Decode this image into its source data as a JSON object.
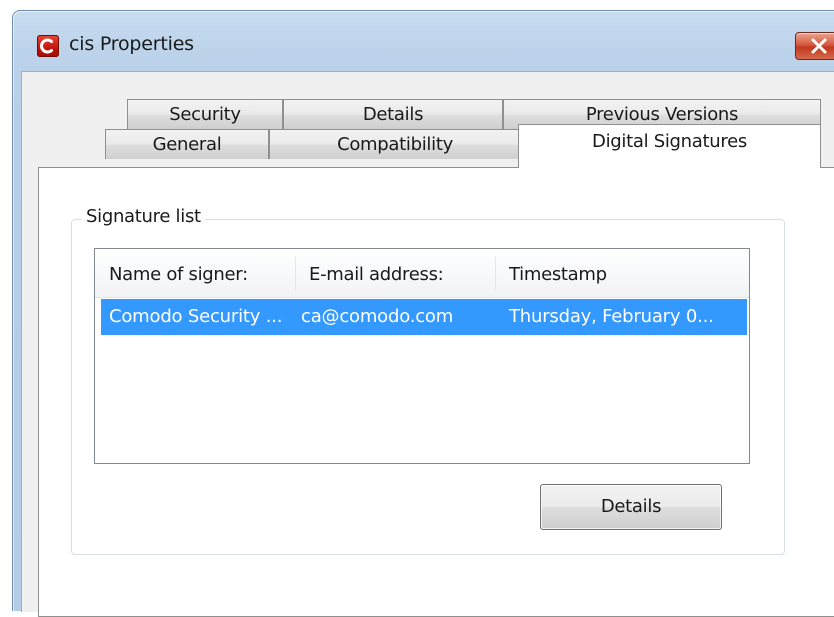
{
  "window": {
    "title": "cis Properties",
    "app_icon": "comodo-c-icon",
    "close_icon": "close-x-icon"
  },
  "tabs": {
    "row1": [
      {
        "label": "Security"
      },
      {
        "label": "Details"
      },
      {
        "label": "Previous Versions"
      }
    ],
    "row2": [
      {
        "label": "General"
      },
      {
        "label": "Compatibility"
      },
      {
        "label": "Digital Signatures"
      }
    ],
    "selected": "Digital Signatures"
  },
  "signature_list": {
    "group_label": "Signature list",
    "columns": [
      "Name of signer:",
      "E-mail address:",
      "Timestamp"
    ],
    "rows": [
      {
        "signer": "Comodo Security ...",
        "email": "ca@comodo.com",
        "timestamp": "Thursday, February 0...",
        "selected": true
      }
    ],
    "details_button": "Details"
  },
  "colors": {
    "selection": "#3399ff",
    "window_frame": "#b9d1ea",
    "close_button": "#c7432a"
  }
}
